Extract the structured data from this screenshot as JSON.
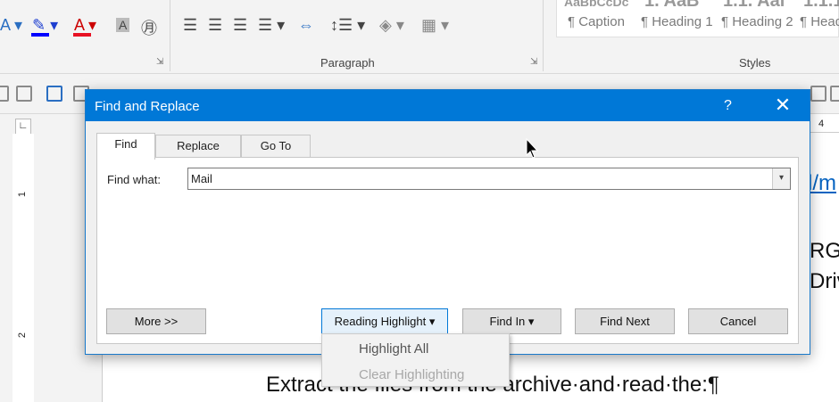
{
  "ribbon": {
    "paragraph_label": "Paragraph",
    "styles_label": "Styles",
    "styles": [
      {
        "name": "¶ Caption"
      },
      {
        "name": "¶ Heading 1"
      },
      {
        "name": "¶ Heading 2"
      },
      {
        "name": "¶ Head"
      }
    ],
    "style_previews": [
      "AaBbCcDc",
      "1. AaB",
      "1.1. Aal",
      "1.1.1."
    ]
  },
  "ruler": {
    "top_mark": "4",
    "left_marks": [
      "1",
      "2"
    ]
  },
  "document": {
    "frag_link": "l/m",
    "frag_line1": "RG",
    "frag_line2": "Driv",
    "body_line": "Extract the files from the archive·and·read·the:¶"
  },
  "dialog": {
    "title": "Find and Replace",
    "help": "?",
    "close": "✕",
    "tabs": [
      {
        "label": "Find",
        "active": true
      },
      {
        "label": "Replace",
        "active": false
      },
      {
        "label": "Go To",
        "active": false
      }
    ],
    "find_label": "Find what:",
    "find_value": "Mail",
    "buttons": {
      "more": "More >>",
      "reading_highlight": "Reading Highlight ▾",
      "find_in": "Find In ▾",
      "find_next": "Find Next",
      "cancel": "Cancel"
    }
  },
  "highlight_menu": {
    "items": [
      {
        "label": "Highlight All",
        "enabled": true
      },
      {
        "label": "Clear Highlighting",
        "enabled": false
      }
    ]
  },
  "colors": {
    "accent": "#0078d7",
    "font_red": "#e81123",
    "highlight_blue": "#0000ff"
  }
}
